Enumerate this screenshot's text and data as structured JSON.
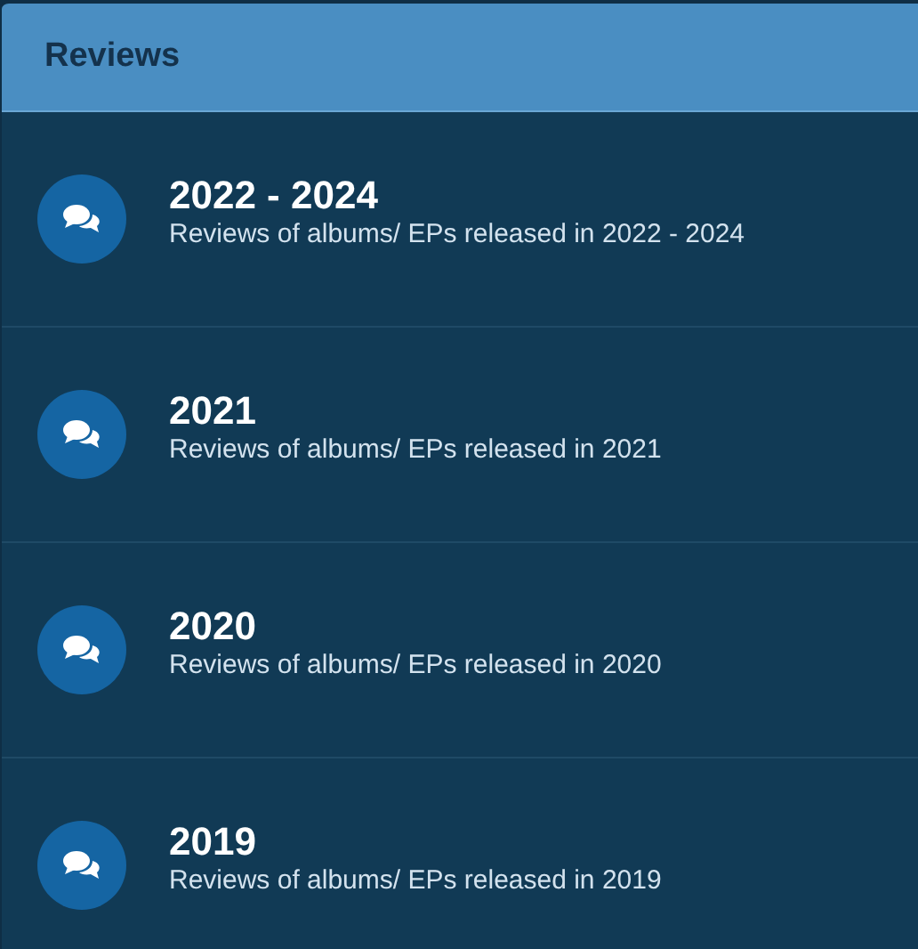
{
  "header": {
    "title": "Reviews"
  },
  "forums": [
    {
      "title": "2022 - 2024",
      "description": "Reviews of albums/ EPs released in 2022 - 2024"
    },
    {
      "title": "2021",
      "description": "Reviews of albums/ EPs released in 2021"
    },
    {
      "title": "2020",
      "description": "Reviews of albums/ EPs released in 2020"
    },
    {
      "title": "2019",
      "description": "Reviews of albums/ EPs released in 2019"
    }
  ]
}
